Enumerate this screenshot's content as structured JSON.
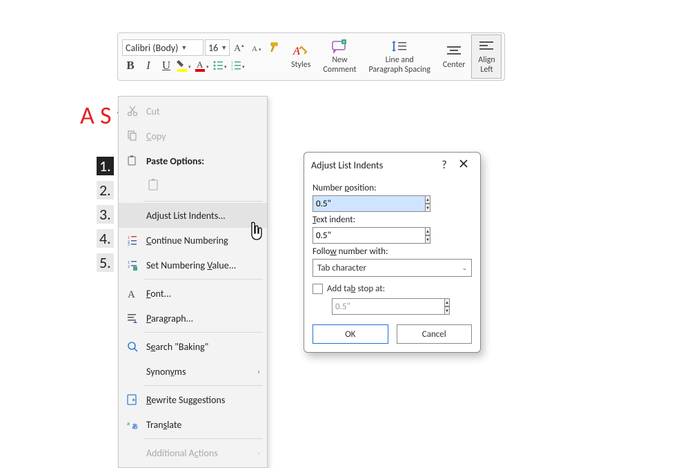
{
  "ribbon": {
    "font_name": "Calibri (Body)",
    "font_size": "16",
    "styles": "Styles",
    "new_comment1": "New",
    "new_comment2": "Comment",
    "line1": "Line and",
    "line2": "Paragraph Spacing",
    "center": "Center",
    "align1": "Align",
    "align2": "Left"
  },
  "heading": "A S                          y List",
  "numbers": [
    "1.",
    "2.",
    "3.",
    "4.",
    "5."
  ],
  "ctx": {
    "cut": "Cut",
    "copy": "Copy",
    "paste_options": "Paste Options:",
    "adjust": "Adjust List Indents...",
    "continue": "Continue Numbering",
    "setnum": "Set Numbering Value...",
    "font": "Font...",
    "paragraph": "Paragraph...",
    "search": "Search \"Baking\"",
    "synonyms": "Synonyms",
    "rewrite": "Rewrite Suggestions",
    "translate": "Translate",
    "additional": "Additional Actions"
  },
  "dialog": {
    "title": "Adjust List Indents",
    "num_pos_label": "Number position:",
    "num_pos_value": "0.5\"",
    "text_indent_label": "Text indent:",
    "text_indent_value": "0.5\"",
    "follow_label": "Follow number with:",
    "follow_value": "Tab character",
    "add_tab": "Add tab stop at:",
    "tab_value": "0.5\"",
    "ok": "OK",
    "cancel": "Cancel"
  }
}
